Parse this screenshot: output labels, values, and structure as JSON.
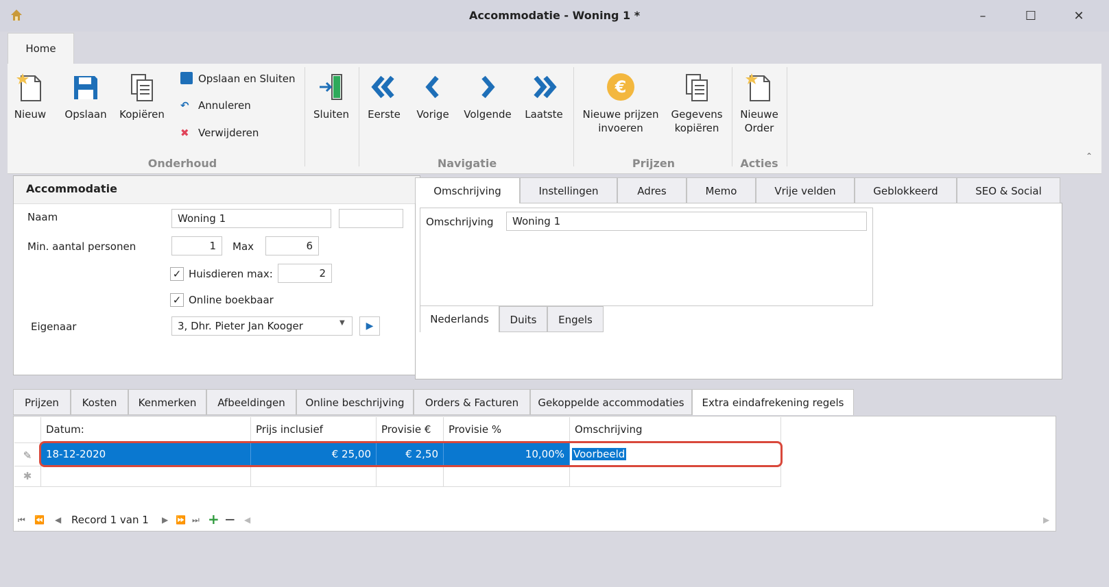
{
  "window": {
    "title": "Accommodatie - Woning 1 *"
  },
  "ribbon": {
    "tab": "Home",
    "onderhoud": {
      "group": "Onderhoud",
      "nieuw": "Nieuw",
      "opslaan": "Opslaan",
      "kopieren": "Kopiëren",
      "opslaan_sluiten": "Opslaan en Sluiten",
      "annuleren": "Annuleren",
      "verwijderen": "Verwijderen",
      "sluiten": "Sluiten"
    },
    "navigatie": {
      "group": "Navigatie",
      "eerste": "Eerste",
      "vorige": "Vorige",
      "volgende": "Volgende",
      "laatste": "Laatste"
    },
    "prijzen": {
      "group": "Prijzen",
      "nieuwe_prijzen_1": "Nieuwe prijzen",
      "nieuwe_prijzen_2": "invoeren",
      "gegevens_1": "Gegevens",
      "gegevens_2": "kopiëren"
    },
    "acties": {
      "group": "Acties",
      "order_1": "Nieuwe",
      "order_2": "Order"
    }
  },
  "accommodatie": {
    "header": "Accommodatie",
    "naam_label": "Naam",
    "naam_value": "Woning 1",
    "naam_extra": "",
    "min_label": "Min. aantal personen",
    "min_value": "1",
    "max_label": "Max",
    "max_value": "6",
    "huisdieren_label": "Huisdieren max:",
    "huisdieren_checked": "✓",
    "huisdieren_value": "2",
    "online_label": "Online boekbaar",
    "online_checked": "✓",
    "eigenaar_label": "Eigenaar",
    "eigenaar_value": "3, Dhr. Pieter Jan Kooger"
  },
  "right_tabs": [
    "Omschrijving",
    "Instellingen",
    "Adres",
    "Memo",
    "Vrije velden",
    "Geblokkeerd",
    "SEO & Social"
  ],
  "omschrijving": {
    "label": "Omschrijving",
    "value": "Woning 1",
    "lang_tabs": [
      "Nederlands",
      "Duits",
      "Engels"
    ]
  },
  "bottom_tabs": [
    "Prijzen",
    "Kosten",
    "Kenmerken",
    "Afbeeldingen",
    "Online beschrijving",
    "Orders & Facturen",
    "Gekoppelde accommodaties",
    "Extra eindafrekening regels"
  ],
  "grid": {
    "columns": [
      "Datum:",
      "Prijs inclusief",
      "Provisie €",
      "Provisie %",
      "Omschrijving"
    ],
    "rows": [
      {
        "datum": "18-12-2020",
        "prijs": "€ 25,00",
        "provisie_eur": "€ 2,50",
        "provisie_pct": "10,00%",
        "omschrijving": "Voorbeeld"
      }
    ]
  },
  "navigator": {
    "record_text": "Record 1 van 1"
  }
}
